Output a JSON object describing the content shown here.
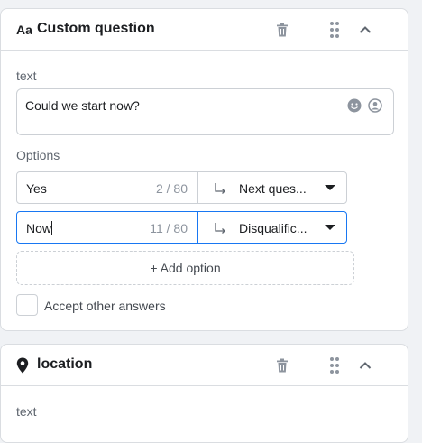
{
  "card1": {
    "title": "Custom question",
    "text_label": "text",
    "text_value": "Could we start now?",
    "options_label": "Options",
    "options": [
      {
        "answer": "Yes",
        "count": "2 / 80",
        "destination": "Next ques..."
      },
      {
        "answer": "Now",
        "count": "11 / 80",
        "destination": "Disqualific..."
      }
    ],
    "add_option": "+ Add option",
    "accept_other": "Accept other answers",
    "accept_other_checked": false
  },
  "card2": {
    "title": "location",
    "text_label": "text"
  },
  "icons": {
    "question_type": "text-format-icon",
    "delete": "trash-icon",
    "drag": "drag-handle-icon",
    "collapse": "chevron-up-icon",
    "emoji": "emoji-icon",
    "person": "person-icon",
    "branch": "branch-arrow-icon",
    "dropdown": "caret-down-icon",
    "location": "location-pin-icon"
  },
  "colors": {
    "active_border": "#1877f2",
    "border": "#ccd0d5",
    "background": "#f0f2f5"
  }
}
